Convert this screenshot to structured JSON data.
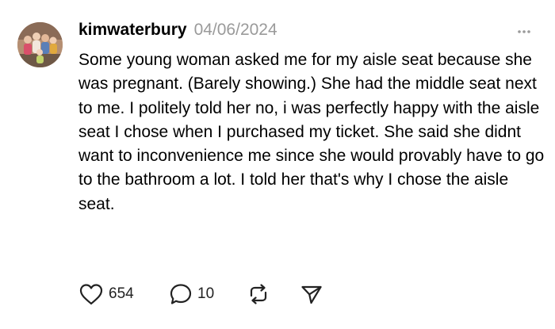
{
  "post": {
    "username": "kimwaterbury",
    "date": "04/06/2024",
    "text": "Some young woman asked me for my aisle seat because she was pregnant. (Barely showing.) She had the middle seat next to me. I politely told her no, i was perfectly happy with the aisle seat I chose when I purchased my ticket. She said she didnt want to inconvenience me since she would provably have to go to the bathroom a lot. I told her that's why I chose the aisle seat.",
    "avatar_icon": "avatar-photo"
  },
  "actions": {
    "like": {
      "icon": "heart-icon",
      "count": "654"
    },
    "reply": {
      "icon": "comment-bubble-icon",
      "count": "10"
    },
    "repost": {
      "icon": "repost-icon"
    },
    "share": {
      "icon": "send-icon"
    }
  },
  "menu": {
    "icon": "more-options-icon"
  },
  "colors": {
    "text": "#000000",
    "muted": "#9a9a9a",
    "icon": "#222222",
    "background": "#ffffff"
  }
}
